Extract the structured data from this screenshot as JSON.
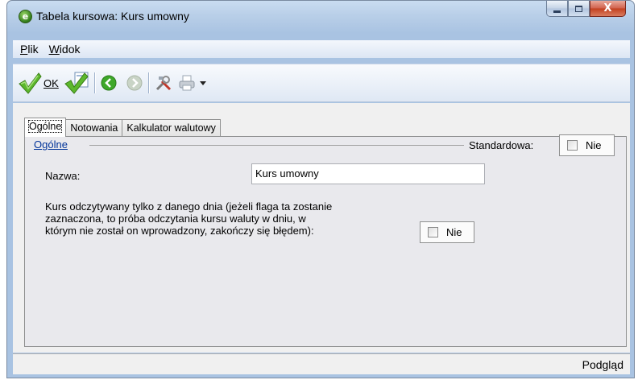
{
  "window": {
    "title": "Tabela kursowa: Kurs umowny",
    "close_glyph": "X"
  },
  "menu": {
    "items": [
      {
        "label_u": "P",
        "label_rest": "lik"
      },
      {
        "label_u": "W",
        "label_rest": "idok"
      }
    ]
  },
  "toolbar": {
    "ok_label": "OK",
    "icons": [
      "checkmark-icon",
      "checkmark-save-icon",
      "back-arrow-icon",
      "forward-arrow-icon",
      "tools-icon",
      "printer-icon",
      "dropdown-arrow-icon"
    ]
  },
  "tabs": [
    {
      "label": "Ogólne",
      "active": true
    },
    {
      "label": "Notowania",
      "active": false
    },
    {
      "label": "Kalkulator walutowy",
      "active": false
    }
  ],
  "section": {
    "title_u": "O",
    "title_rest": "gólne",
    "standard_label": "Standardowa:",
    "standard_value": "Nie"
  },
  "form": {
    "name_label": "Nazwa:",
    "name_value": "Kurs umowny",
    "date_desc_line1": "Kurs odczytywany tylko z danego dnia (jeżeli flaga ta zostanie",
    "date_desc_line2": "zaznaczona, to próba odczytania kursu waluty w dniu, w",
    "date_desc_line3": "którym nie został on wprowadzony, zakończy się błędem):",
    "date_flag_value": "Nie"
  },
  "status": {
    "text": "Podgląd"
  },
  "colors": {
    "accent_link": "#003399",
    "check_green": "#5cb82c"
  }
}
